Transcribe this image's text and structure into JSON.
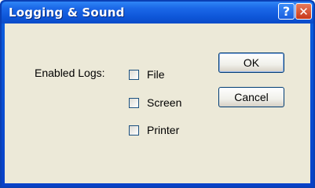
{
  "window": {
    "title": "Logging & Sound",
    "help_glyph": "?",
    "close_glyph": "✕"
  },
  "logs": {
    "label": "Enabled Logs:",
    "options": [
      {
        "label": "File",
        "checked": false
      },
      {
        "label": "Screen",
        "checked": false
      },
      {
        "label": "Printer",
        "checked": false
      }
    ]
  },
  "buttons": {
    "ok": "OK",
    "cancel": "Cancel"
  },
  "icons": {
    "help": "help-icon",
    "close": "close-icon"
  },
  "colors": {
    "titlebar": "#0a4bc8",
    "client_bg": "#ece9d8",
    "close_button": "#c8381a"
  }
}
